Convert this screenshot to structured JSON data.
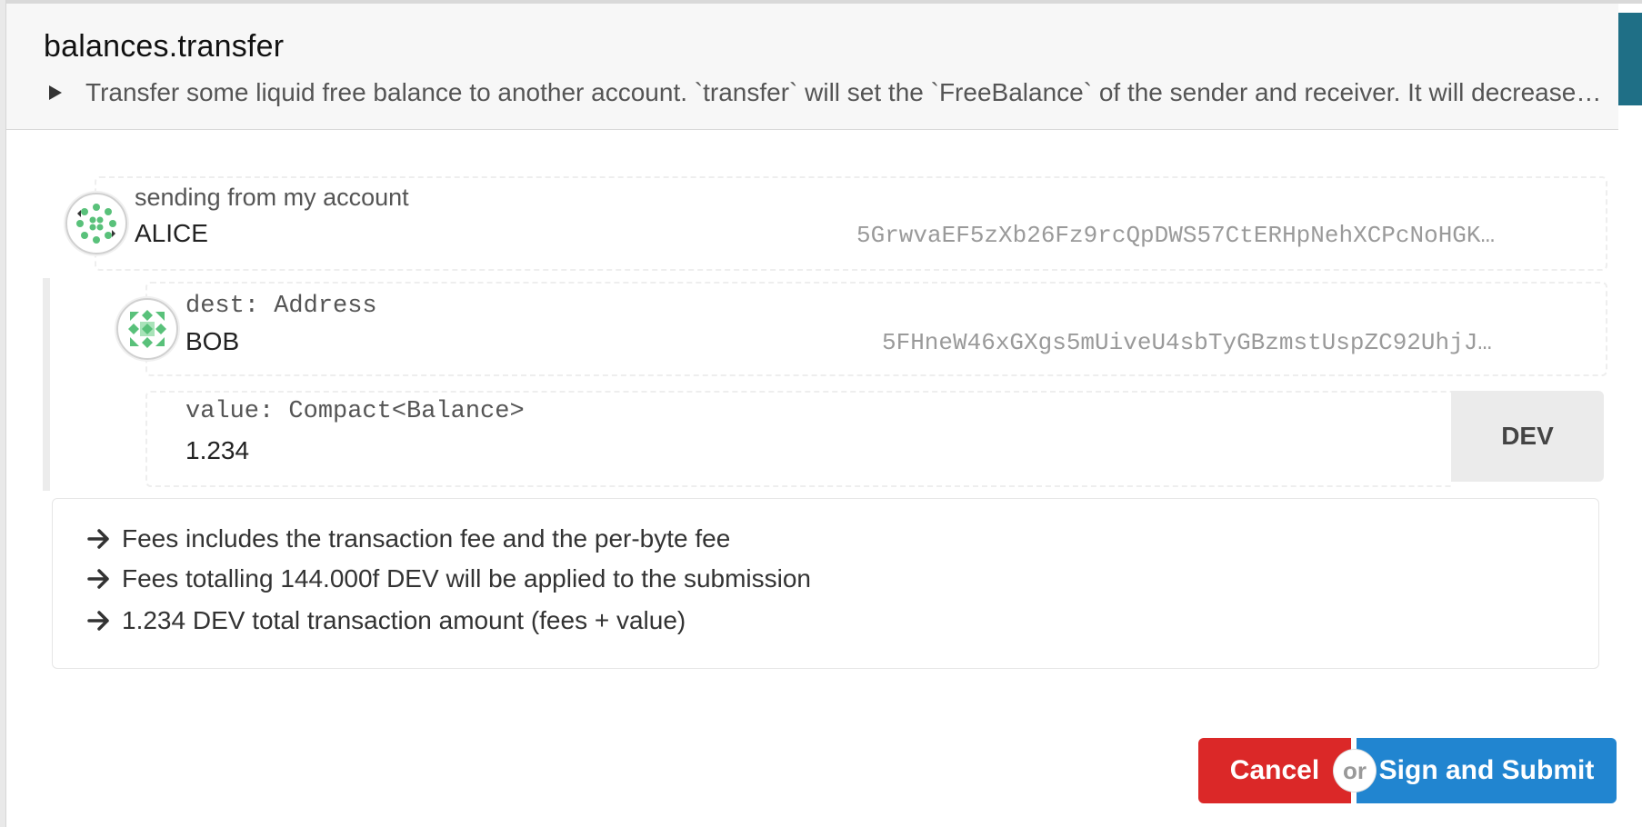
{
  "header": {
    "title": "balances.transfer",
    "description": "Transfer some liquid free balance to another account. `transfer` will set the `FreeBalance` of the sender and receiver. It will decrease…"
  },
  "sender": {
    "label": "sending from my account",
    "name": "ALICE",
    "address": "5GrwvaEF5zXb26Fz9rcQpDWS57CtERHpNehXCPcNoHGK…",
    "icon": "identicon-alice"
  },
  "params": {
    "dest": {
      "label": "dest: Address",
      "name": "BOB",
      "address": "5FHneW46xGXgs5mUiveU4sbTyGBzmstUspZC92UhjJ…",
      "icon": "identicon-bob"
    },
    "value": {
      "label": "value: Compact<Balance>",
      "amount": "1.234",
      "unit": "DEV"
    }
  },
  "fees": {
    "lines": [
      "Fees includes the transaction fee and the per-byte fee",
      "Fees totalling 144.000f DEV will be applied to the submission",
      "1.234 DEV total transaction amount (fees + value)"
    ],
    "icon": "arrow-right-icon"
  },
  "actions": {
    "cancel_label": "Cancel",
    "or_label": "or",
    "submit_label": "Sign and Submit"
  },
  "colors": {
    "cancel": "#db2828",
    "submit": "#2185d0",
    "identicon_green": "#59c17a",
    "accent": "#1f6f86"
  }
}
